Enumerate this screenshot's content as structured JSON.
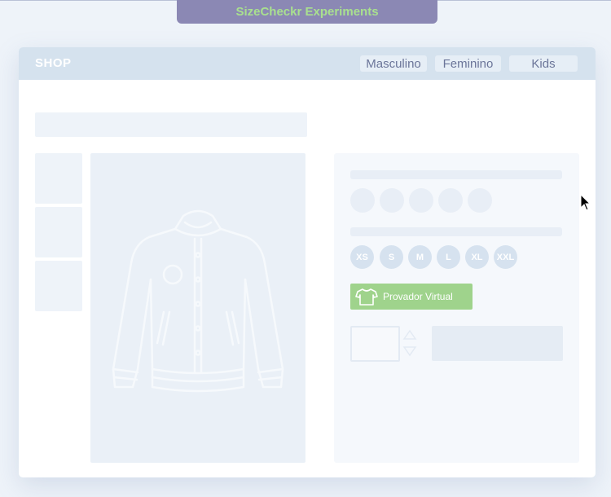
{
  "experiment_tab": {
    "label": "SizeCheckr Experiments"
  },
  "shop": {
    "logo": "SHOP",
    "nav": [
      {
        "label": "Masculino"
      },
      {
        "label": "Feminino"
      },
      {
        "label": "Kids"
      }
    ]
  },
  "product": {
    "sizes": [
      {
        "label": "XS"
      },
      {
        "label": "S"
      },
      {
        "label": "M"
      },
      {
        "label": "L"
      },
      {
        "label": "XL"
      },
      {
        "label": "XXL"
      }
    ],
    "try_on_button": "Provador Virtual"
  },
  "colors": {
    "accent_green": "#9fd38c",
    "tab_purple": "#8b88b4",
    "nav_blue": "#d5e2ee"
  },
  "icons": {
    "try_on": "tshirt-icon",
    "main_image": "jacket-illustration",
    "stepper_up": "chevron-up-icon",
    "stepper_down": "chevron-down-icon",
    "pointer": "mouse-cursor-icon"
  }
}
